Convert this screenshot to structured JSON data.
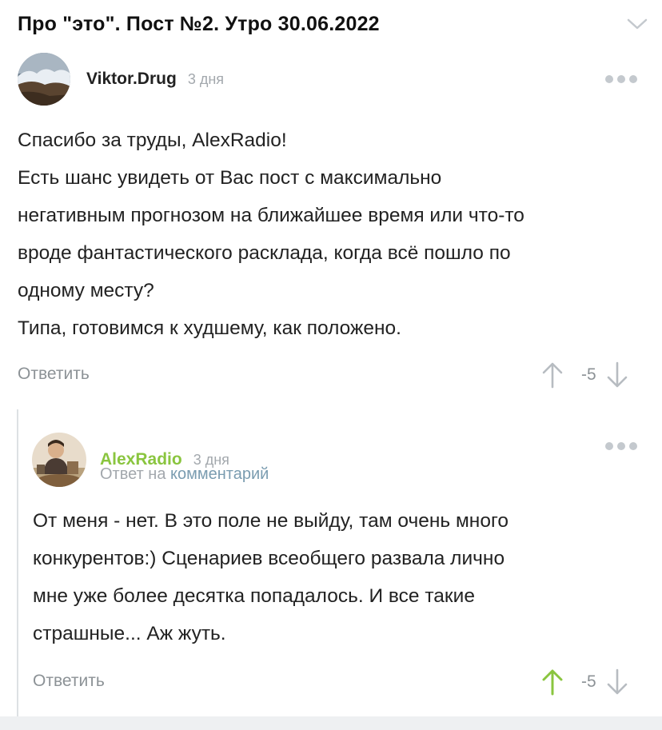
{
  "post": {
    "title": "Про \"это\". Пост №2. Утро 30.06.2022"
  },
  "comments": [
    {
      "author": "Viktor.Drug",
      "time": "3 дня",
      "lines": [
        "Спасибо за труды, AlexRadio!",
        "Есть шанс увидеть от Вас пост с максимально",
        "негативным прогнозом на ближайшее время или что-то",
        "вроде фантастического расклада, когда всё пошло по",
        "одному месту?",
        "Типа, готовимся к худшему, как положено."
      ],
      "reply_label": "Ответить",
      "rating": "-5"
    },
    {
      "author": "AlexRadio",
      "time": "3 дня",
      "reply_to_prefix": "Ответ на",
      "reply_to_link": "комментарий",
      "lines": [
        "От меня - нет. В это поле не выйду, там очень много",
        "конкурентов:) Сценариев всеобщего развала лично",
        "мне уже более десятка попадалось. И все такие",
        "страшные... Аж жуть."
      ],
      "reply_label": "Ответить",
      "rating": "-5"
    }
  ],
  "colors": {
    "author_highlight": "#8ac53f",
    "upvote_active": "#8ac53f",
    "muted": "#8c9296"
  },
  "icons": [
    "chevron-down-icon",
    "more-dots-icon",
    "arrow-up-icon",
    "arrow-down-icon"
  ]
}
